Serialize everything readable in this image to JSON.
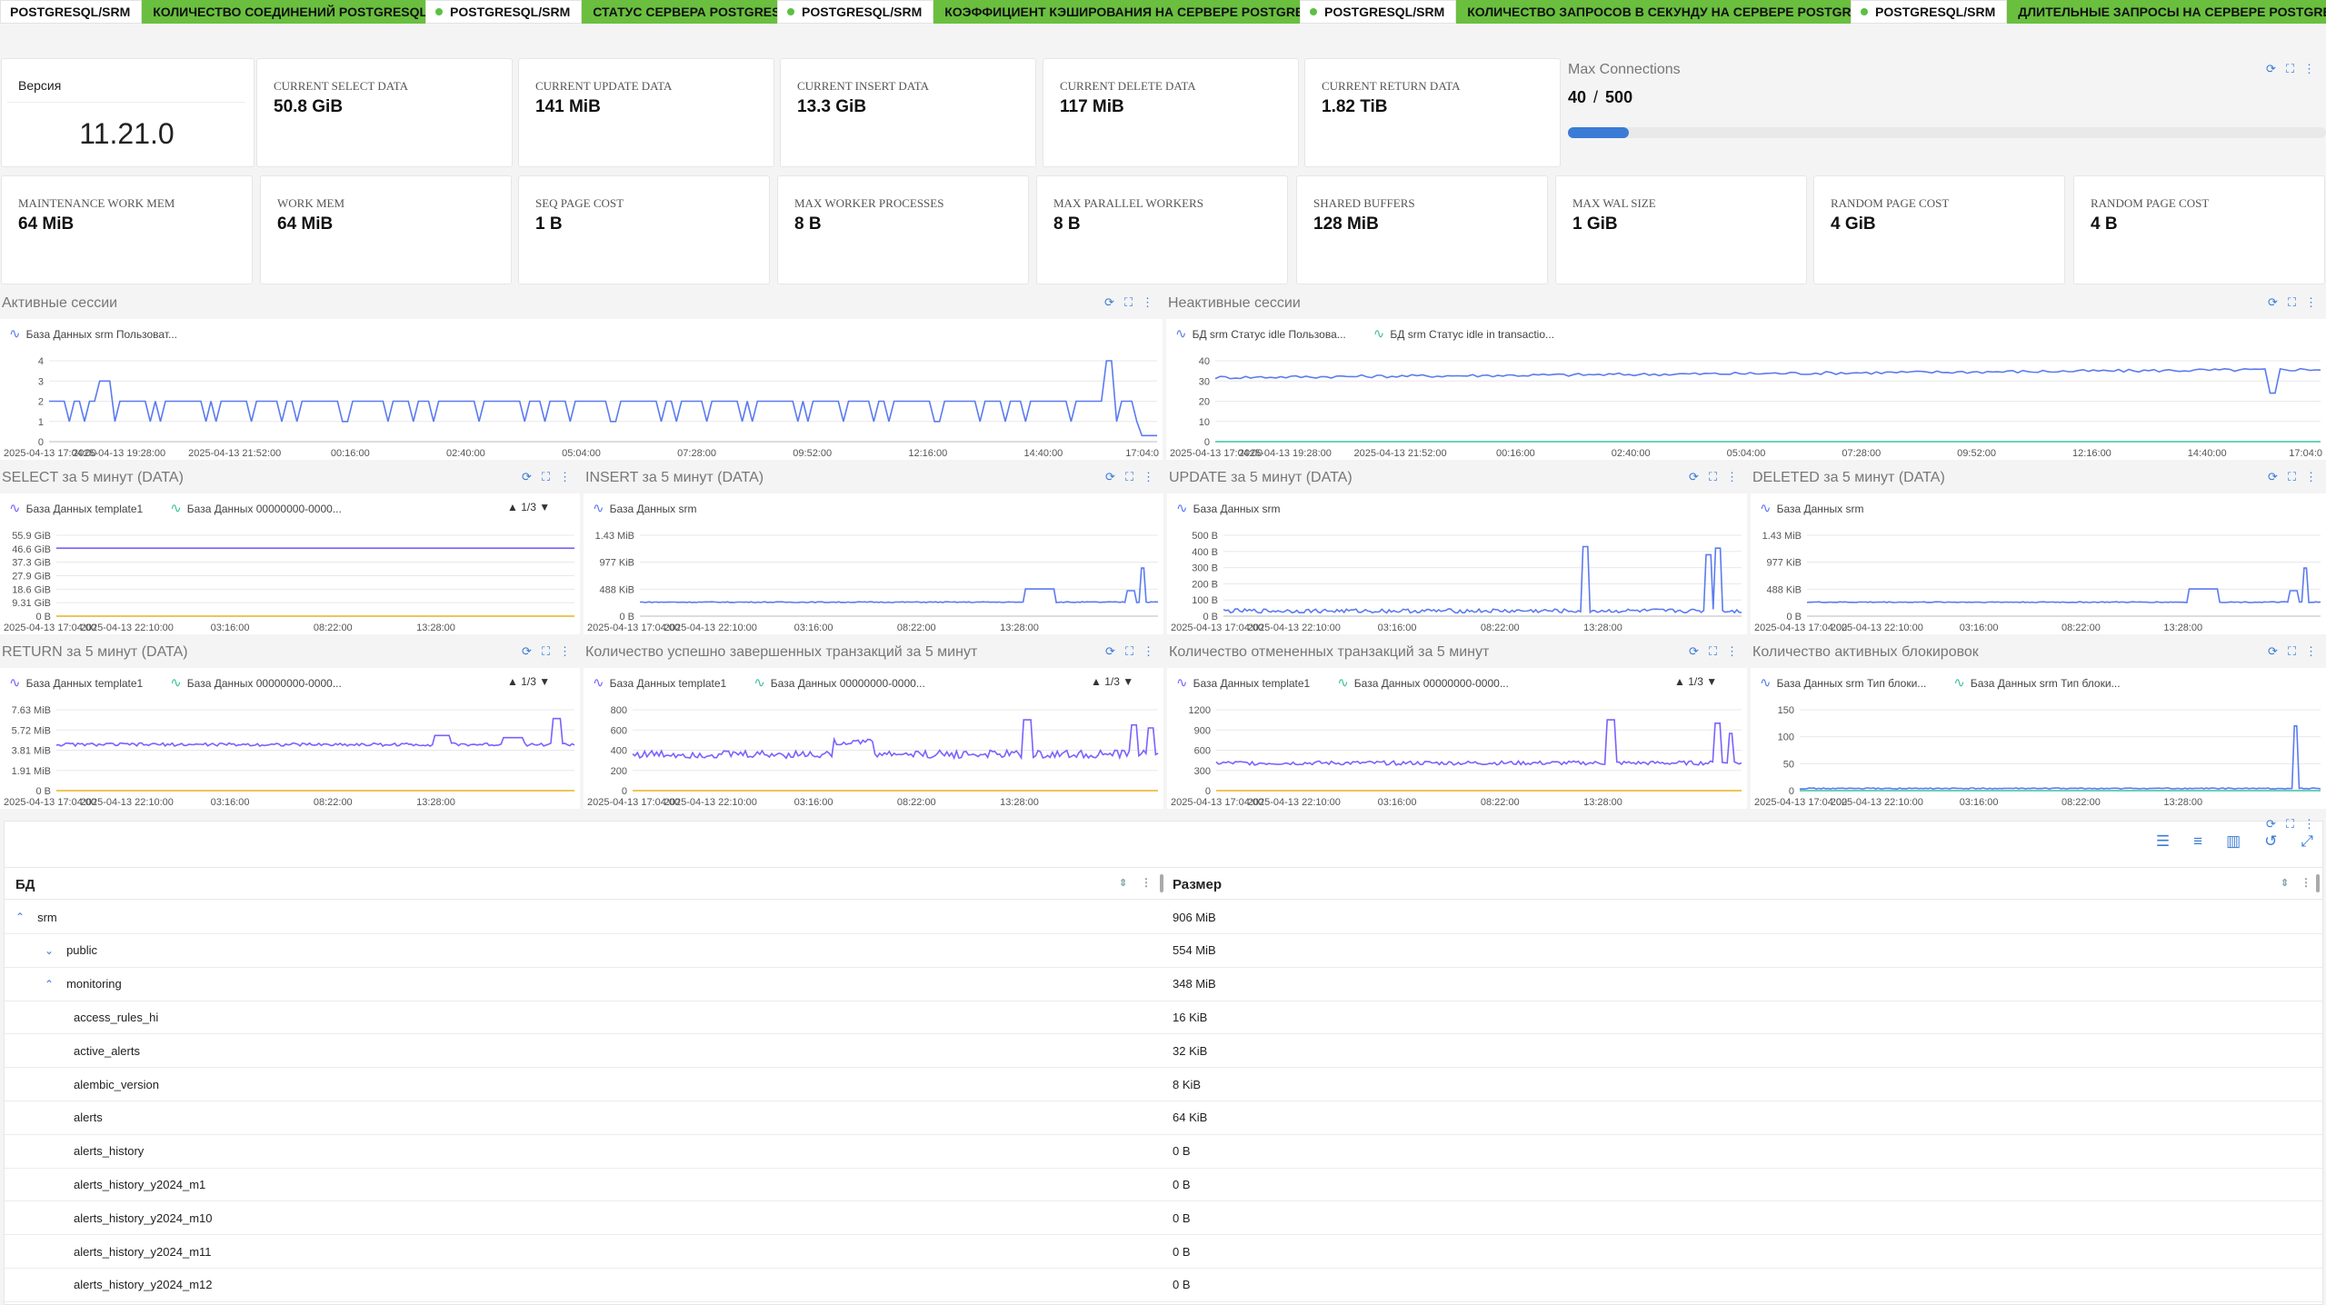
{
  "tags": [
    {
      "left": "POSTGRESQL/SRM",
      "right": "КОЛИЧЕСТВО СОЕДИНЕНИЙ POSTGRESQL",
      "dot": false
    },
    {
      "left": "POSTGRESQL/SRM",
      "right": "СТАТУС СЕРВЕРА POSTGRESQL",
      "dot": true
    },
    {
      "left": "POSTGRESQL/SRM",
      "right": "КОЭФФИЦИЕНТ КЭШИРОВАНИЯ НА СЕРВЕРЕ POSTGRESQL",
      "dot": true
    },
    {
      "left": "POSTGRESQL/SRM",
      "right": "КОЛИЧЕСТВО ЗАПРОСОВ В СЕКУНДУ НА СЕРВЕРЕ POSTGRESQL",
      "dot": true
    },
    {
      "left": "POSTGRESQL/SRM",
      "right": "ДЛИТЕЛЬНЫЕ ЗАПРОСЫ НА СЕРВЕРЕ POSTGRESQL",
      "dot": true
    }
  ],
  "version": {
    "label": "Версия",
    "value": "11.21.0"
  },
  "stats_row1": [
    {
      "label": "CURRENT SELECT DATA",
      "value": "50.8 GiB"
    },
    {
      "label": "CURRENT UPDATE DATA",
      "value": "141 MiB"
    },
    {
      "label": "CURRENT INSERT DATA",
      "value": "13.3 GiB"
    },
    {
      "label": "CURRENT DELETE DATA",
      "value": "117 MiB"
    },
    {
      "label": "CURRENT RETURN DATA",
      "value": "1.82 TiB"
    }
  ],
  "max_connections": {
    "title": "Max Connections",
    "current": "40",
    "separator": "/",
    "max": "500",
    "fraction": 0.08
  },
  "stats_row2": [
    {
      "label": "MAINTENANCE WORK MEM",
      "value": "64 MiB"
    },
    {
      "label": "WORK MEM",
      "value": "64 MiB"
    },
    {
      "label": "SEQ PAGE COST",
      "value": "1 B"
    },
    {
      "label": "MAX WORKER PROCESSES",
      "value": "8 B"
    },
    {
      "label": "MAX PARALLEL WORKERS",
      "value": "8 B"
    },
    {
      "label": "SHARED BUFFERS",
      "value": "128 MiB"
    },
    {
      "label": "MAX WAL SIZE",
      "value": "1 GiB"
    },
    {
      "label": "RANDOM PAGE COST",
      "value": "4 GiB"
    },
    {
      "label": "RANDOM PAGE COST",
      "value": "4 B"
    }
  ],
  "colors": {
    "accent": "#3a7bd5",
    "tag_green": "#6abf3f",
    "line_blue": "#5b7bf0",
    "line_purple": "#7b61ff",
    "line_yellow": "#e6b422",
    "line_teal": "#3cc2a0"
  },
  "panels": [
    {
      "title": "Активные сессии",
      "pager": "",
      "legend": [
        {
          "name": "База Данных  srm Пользоват...",
          "color": "#5b7bf0"
        }
      ],
      "yticks": [
        "4",
        "3",
        "2",
        "1",
        "0"
      ],
      "xticks": [
        "2025-04-13 17:04:00",
        "2025-04-13 19:28:00",
        "2025-04-13 21:52:00",
        "00:16:00",
        "02:40:00",
        "05:04:00",
        "07:28:00",
        "09:52:00",
        "12:16:00",
        "14:40:00",
        "17:04:0"
      ],
      "chart_data": {
        "type": "line",
        "ylim": [
          0,
          4
        ],
        "series": [
          {
            "name": "База Данных  srm Пользоват...",
            "color": "#5b7bf0",
            "kind": "active"
          }
        ]
      }
    },
    {
      "title": "Неактивные сессии",
      "pager": "",
      "legend": [
        {
          "name": "БД srm Статус idle Пользова...",
          "color": "#5b7bf0"
        },
        {
          "name": "БД srm Статус idle in transactio...",
          "color": "#3cc2a0"
        }
      ],
      "yticks": [
        "40",
        "30",
        "20",
        "10",
        "0"
      ],
      "xticks": [
        "2025-04-13 17:04:00",
        "2025-04-13 19:28:00",
        "2025-04-13 21:52:00",
        "00:16:00",
        "02:40:00",
        "05:04:00",
        "07:28:00",
        "09:52:00",
        "12:16:00",
        "14:40:00",
        "17:04:0"
      ],
      "chart_data": {
        "type": "line",
        "ylim": [
          0,
          40
        ],
        "series": [
          {
            "name": "БД srm Статус idle Пользова...",
            "color": "#5b7bf0",
            "kind": "idle"
          },
          {
            "name": "БД srm Статус idle in transactio...",
            "color": "#3cc2a0",
            "kind": "zero"
          }
        ]
      }
    },
    {
      "title": "SELECT за 5 минут (DATA)",
      "pager": "1/3",
      "legend": [
        {
          "name": "База Данных  template1",
          "color": "#7b61ff"
        },
        {
          "name": "База Данных  00000000-0000...",
          "color": "#3cc2a0"
        }
      ],
      "yticks": [
        "55.9 GiB",
        "46.6 GiB",
        "37.3 GiB",
        "27.9 GiB",
        "18.6 GiB",
        "9.31 GiB",
        "0 B"
      ],
      "xticks": [
        "2025-04-13 17:04:00",
        "2025-04-13 22:10:00",
        "03:16:00",
        "08:22:00",
        "13:28:00"
      ],
      "chart_data": {
        "type": "line",
        "ylim": [
          0,
          55.9
        ],
        "series": [
          {
            "name": "База Данных  template1",
            "color": "#7b61ff",
            "kind": "flathigh"
          },
          {
            "name": "База Данных  00000000-0000...",
            "color": "#e6b422",
            "kind": "zero"
          }
        ]
      }
    },
    {
      "title": "INSERT за 5 минут (DATA)",
      "pager": "",
      "legend": [
        {
          "name": "База Данных  srm",
          "color": "#5b7bf0"
        }
      ],
      "yticks": [
        "1.43 MiB",
        "977 KiB",
        "488 KiB",
        "0 B"
      ],
      "xticks": [
        "2025-04-13 17:04:00",
        "2025-04-13 22:10:00",
        "03:16:00",
        "08:22:00",
        "13:28:00"
      ],
      "chart_data": {
        "type": "line",
        "ylim": [
          0,
          1.43
        ],
        "series": [
          {
            "name": "База Данных  srm",
            "color": "#5b7bf0",
            "kind": "insert"
          }
        ]
      }
    },
    {
      "title": "UPDATE за 5 минут (DATA)",
      "pager": "",
      "legend": [
        {
          "name": "База Данных  srm",
          "color": "#5b7bf0"
        }
      ],
      "yticks": [
        "500 B",
        "400 B",
        "300 B",
        "200 B",
        "100 B",
        "0 B"
      ],
      "xticks": [
        "2025-04-13 17:04:00",
        "2025-04-13 22:10:00",
        "03:16:00",
        "08:22:00",
        "13:28:00"
      ],
      "chart_data": {
        "type": "line",
        "ylim": [
          0,
          500
        ],
        "series": [
          {
            "name": "База Данных  srm",
            "color": "#5b7bf0",
            "kind": "update"
          }
        ]
      }
    },
    {
      "title": "DELETED за 5 минут (DATA)",
      "pager": "",
      "legend": [
        {
          "name": "База Данных  srm",
          "color": "#5b7bf0"
        }
      ],
      "yticks": [
        "1.43 MiB",
        "977 KiB",
        "488 KiB",
        "0 B"
      ],
      "xticks": [
        "2025-04-13 17:04:00",
        "2025-04-13 22:10:00",
        "03:16:00",
        "08:22:00",
        "13:28:00"
      ],
      "chart_data": {
        "type": "line",
        "ylim": [
          0,
          1.43
        ],
        "series": [
          {
            "name": "База Данных  srm",
            "color": "#5b7bf0",
            "kind": "insert"
          }
        ]
      }
    },
    {
      "title": "RETURN за 5 минут (DATA)",
      "pager": "1/3",
      "legend": [
        {
          "name": "База Данных  template1",
          "color": "#7b61ff"
        },
        {
          "name": "База Данных  00000000-0000...",
          "color": "#3cc2a0"
        }
      ],
      "yticks": [
        "7.63 MiB",
        "5.72 MiB",
        "3.81 MiB",
        "1.91 MiB",
        "0 B"
      ],
      "xticks": [
        "2025-04-13 17:04:00",
        "2025-04-13 22:10:00",
        "03:16:00",
        "08:22:00",
        "13:28:00"
      ],
      "chart_data": {
        "type": "line",
        "ylim": [
          0,
          7.63
        ],
        "series": [
          {
            "name": "База Данных  template1",
            "color": "#7b61ff",
            "kind": "return"
          },
          {
            "name": "База Данных  00000000-0000...",
            "color": "#e6b422",
            "kind": "zero"
          }
        ]
      }
    },
    {
      "title": "Количество успешно завершенных транзакций за 5 минут",
      "pager": "1/3",
      "legend": [
        {
          "name": "База Данных  template1",
          "color": "#7b61ff"
        },
        {
          "name": "База Данных  00000000-0000...",
          "color": "#3cc2a0"
        }
      ],
      "yticks": [
        "800",
        "600",
        "400",
        "200",
        "0"
      ],
      "xticks": [
        "2025-04-13 17:04:00",
        "2025-04-13 22:10:00",
        "03:16:00",
        "08:22:00",
        "13:28:00"
      ],
      "chart_data": {
        "type": "line",
        "ylim": [
          0,
          800
        ],
        "series": [
          {
            "name": "База Данных  template1",
            "color": "#7b61ff",
            "kind": "commit"
          },
          {
            "name": "База Данных  00000000-0000...",
            "color": "#e6b422",
            "kind": "zero"
          }
        ]
      }
    },
    {
      "title": "Количество отмененных транзакций за 5 минут",
      "pager": "1/3",
      "legend": [
        {
          "name": "База Данных  template1",
          "color": "#7b61ff"
        },
        {
          "name": "База Данных  00000000-0000...",
          "color": "#3cc2a0"
        }
      ],
      "yticks": [
        "1200",
        "900",
        "600",
        "300",
        "0"
      ],
      "xticks": [
        "2025-04-13 17:04:00",
        "2025-04-13 22:10:00",
        "03:16:00",
        "08:22:00",
        "13:28:00"
      ],
      "chart_data": {
        "type": "line",
        "ylim": [
          0,
          1200
        ],
        "series": [
          {
            "name": "База Данных  template1",
            "color": "#7b61ff",
            "kind": "rollback"
          },
          {
            "name": "База Данных  00000000-0000...",
            "color": "#e6b422",
            "kind": "zero"
          }
        ]
      }
    },
    {
      "title": "Количество активных блокировок",
      "pager": "",
      "legend": [
        {
          "name": "База Данных  srm Тип блоки...",
          "color": "#5b7bf0"
        },
        {
          "name": "База Данных  srm Тип блоки...",
          "color": "#3cc2a0"
        }
      ],
      "yticks": [
        "150",
        "100",
        "50",
        "0"
      ],
      "xticks": [
        "2025-04-13 17:04:00",
        "2025-04-13 22:10:00",
        "03:16:00",
        "08:22:00",
        "13:28:00"
      ],
      "chart_data": {
        "type": "line",
        "ylim": [
          0,
          150
        ],
        "series": [
          {
            "name": "База Данных  srm Тип блоки...",
            "color": "#5b7bf0",
            "kind": "locks"
          },
          {
            "name": "База Данных  srm Тип блоки...",
            "color": "#3cc2a0",
            "kind": "zero"
          }
        ]
      }
    }
  ],
  "table": {
    "col_db": "БД",
    "col_size": "Размер",
    "rows": [
      {
        "name": "srm",
        "size": "906 MiB",
        "level": 0,
        "chevron": "up"
      },
      {
        "name": "public",
        "size": "554 MiB",
        "level": 1,
        "chevron": "down"
      },
      {
        "name": "monitoring",
        "size": "348 MiB",
        "level": 1,
        "chevron": "up"
      },
      {
        "name": "access_rules_hi",
        "size": "16 KiB",
        "level": 2,
        "chevron": ""
      },
      {
        "name": "active_alerts",
        "size": "32 KiB",
        "level": 2,
        "chevron": ""
      },
      {
        "name": "alembic_version",
        "size": "8 KiB",
        "level": 2,
        "chevron": ""
      },
      {
        "name": "alerts",
        "size": "64 KiB",
        "level": 2,
        "chevron": ""
      },
      {
        "name": "alerts_history",
        "size": "0 B",
        "level": 2,
        "chevron": ""
      },
      {
        "name": "alerts_history_y2024_m1",
        "size": "0 B",
        "level": 2,
        "chevron": ""
      },
      {
        "name": "alerts_history_y2024_m10",
        "size": "0 B",
        "level": 2,
        "chevron": ""
      },
      {
        "name": "alerts_history_y2024_m11",
        "size": "0 B",
        "level": 2,
        "chevron": ""
      },
      {
        "name": "alerts_history_y2024_m12",
        "size": "0 B",
        "level": 2,
        "chevron": ""
      }
    ]
  }
}
